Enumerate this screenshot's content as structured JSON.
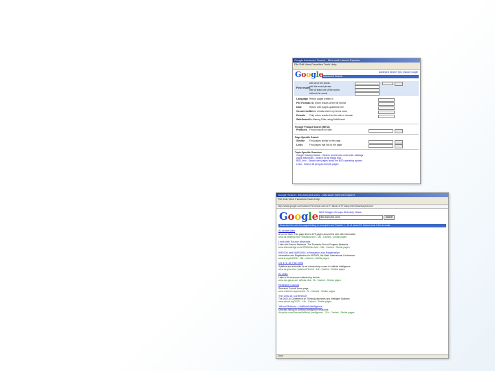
{
  "advanced_search_screenshot": {
    "window_title": "Google Advanced Search - Microsoft Internet Explorer",
    "menu": "File  Edit  View  Favorites  Tools  Help",
    "logo_letters": [
      "G",
      "o",
      "o",
      "g",
      "l",
      "e"
    ],
    "header_bar": "Advanced Search",
    "header_links": "Advanced Search Tips | About Google",
    "find_results_label": "Find results",
    "find_options": [
      "with all of the words",
      "with the exact phrase",
      "with at least one of the words",
      "without the words"
    ],
    "rows": [
      {
        "label": "Language",
        "text": "Return pages written in"
      },
      {
        "label": "File Format",
        "text": "Only return results of the file format"
      },
      {
        "label": "Date",
        "text": "Return web pages updated in the"
      },
      {
        "label": "Occurrences",
        "text": "Return results where my terms occur"
      },
      {
        "label": "Domain",
        "text": "Only return results from the site or domain"
      },
      {
        "label": "SafeSearch",
        "text": "No filtering   Filter using SafeSearch"
      }
    ],
    "search_button": "Google Search",
    "froogle_header": "Froogle Product Search (BETA)",
    "froogle_row": {
      "label": "Products",
      "text": "Find products for sale"
    },
    "page_specific_header": "Page-Specific Search",
    "similar_row": {
      "label": "Similar",
      "text": "Find pages similar to the page"
    },
    "links_row": {
      "label": "Links",
      "text": "Find pages that link to the page"
    },
    "topic_header": "Topic-Specific Searches",
    "topic_lines": [
      "Google Catalog Search - Search and browse mail-order catalogs",
      "Apple Macintosh - Search for all things Mac",
      "BSD Unix - Search web pages about the BSD operating system",
      "Linux - Search all penguin-friendly pages"
    ]
  },
  "results_screenshot": {
    "window_title": "Google Search: link:www.jedi.com/ - Microsoft Internet Explorer",
    "menu": "File  Edit  View  Favorites  Tools  Help",
    "address": "http://www.google.com/search?hl=en&lr=&ie=UTF-8&oe=UTF-8&q=link%3Awww.jedi.com",
    "logo_letters": [
      "G",
      "o",
      "o",
      "g",
      "l",
      "e"
    ],
    "tabs": "Web   Images   Groups   Directory   News",
    "query": "link:www.jedi.com/",
    "search_button": "Search",
    "result_bar": "Searched the web for pages linking to www.jedi.com/      Results 1 - 10 of about 53. Search took 0.16 seconds.",
    "results": [
      {
        "title": "AI on the Web",
        "desc": "AI on the Web: This page links to 870 pages around the web with information",
        "url": "www.cs.berkeley.edu/~russell/ai.html - 34k - Cached - Similar pages"
      },
      {
        "title": "Links with Source Abstracts",
        "desc": "Links with Source Abstracts. The Semantic School Program Abstracts",
        "url": "www.teknowledge.com/HPKB/links.html - 18k - Cached - Similar pages"
      },
      {
        "title": "KR2004 and NMR2004: Information and Registration",
        "desc": "Information and Registration for KR2004, the Ninth International Conference",
        "url": "www.kr.org/kr2004/ - 26k - Cached - Similar pages"
      },
      {
        "title": "CS 471, AI, Fall 1998",
        "desc": "Syllabus and schedule for an introductory course in Artificial Intelligence",
        "url": "www.cs.gmu.edu/~jhale/cs471.html - 11k - Cached - Similar pages"
      },
      {
        "title": "AI Links",
        "desc": "Links to AI resources collected by the lab",
        "url": "www.dcs.gla.ac.uk/~ai/links.html - 9k - Cached - Similar pages"
      },
      {
        "title": "Research Council",
        "desc": "Research Council home page",
        "url": "www.research.org/council/ - 7k - Cached - Similar pages"
      },
      {
        "title": "The 2002 AI Conference",
        "desc": "The 2002 AI Conference on Thinking Machines and Intelligent Systems",
        "url": "www.aiconf.org/2002/ - 14k - Cached - Similar pages"
      },
      {
        "title": "Yahoo! Science > Artificial Intelligence",
        "desc": "Directory listing for Artificial Intelligence resources",
        "url": "dir.yahoo.com/Science/Artificial_Intelligence/ - 21k - Cached - Similar pages"
      }
    ],
    "status": "Done"
  }
}
